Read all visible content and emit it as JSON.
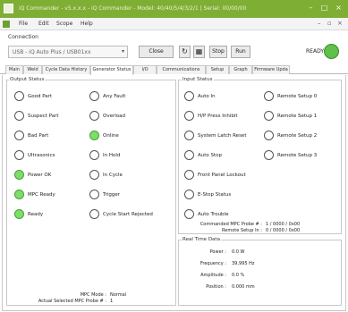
{
  "window": {
    "title": "iQ Commander - v5.x.x.x - iQ Commander - Model: 40/40/5/4/3/2/1 | Serial: 00/00/00",
    "minimize_glyph": "–",
    "maximize_glyph": "□",
    "close_glyph": "×"
  },
  "menubar": {
    "items": [
      "File",
      "Edit",
      "Scope",
      "Help"
    ],
    "mdi_controls": [
      "–",
      "▫",
      "×"
    ]
  },
  "connection": {
    "label": "Connection",
    "selected": "USB - iQ Auto Plus / USB01xx",
    "caret": "▾",
    "close_label": "Close",
    "refresh_glyph": "↻",
    "grid_glyph": "▦",
    "stop_label": "Stop",
    "run_label": "Run",
    "ready_label": "READY",
    "ready_color": "#5fc04a"
  },
  "tabs": [
    {
      "label": "Main"
    },
    {
      "label": "Weld"
    },
    {
      "label": "Cycle Data History"
    },
    {
      "label": "Generator Status",
      "active": true
    },
    {
      "label": "I/O"
    },
    {
      "label": "Communications"
    },
    {
      "label": "Setup"
    },
    {
      "label": "Graph"
    },
    {
      "label": "Firmware Upda"
    }
  ],
  "output_status": {
    "title": "Output Status",
    "left": [
      {
        "label": "Good Part",
        "on": false
      },
      {
        "label": "Suspect Part",
        "on": false
      },
      {
        "label": "Bad Part",
        "on": false
      },
      {
        "label": "Ultrasonics",
        "on": false
      },
      {
        "label": "Power OK",
        "on": true
      },
      {
        "label": "MPC Ready",
        "on": true
      },
      {
        "label": "Ready",
        "on": true
      }
    ],
    "right": [
      {
        "label": "Any Fault",
        "on": false
      },
      {
        "label": "Overload",
        "on": false
      },
      {
        "label": "Online",
        "on": true
      },
      {
        "label": "In Hold",
        "on": false
      },
      {
        "label": "In Cycle",
        "on": false
      },
      {
        "label": "Trigger",
        "on": false
      },
      {
        "label": "Cycle Start Rejected",
        "on": false
      }
    ],
    "mpc_mode_label": "MPC Mode :",
    "mpc_mode_value": "Normal",
    "actual_probe_label": "Actual Selected MPC Probe # :",
    "actual_probe_value": "1"
  },
  "input_status": {
    "title": "Input Status",
    "left": [
      {
        "label": "Auto In",
        "on": false
      },
      {
        "label": "H/P Press Inhibit",
        "on": false
      },
      {
        "label": "System Latch Reset",
        "on": false
      },
      {
        "label": "Auto Stop",
        "on": false
      },
      {
        "label": "Front Panel Lockout",
        "on": false
      },
      {
        "label": "E-Stop Status",
        "on": false
      },
      {
        "label": "Auto Trouble",
        "on": false
      }
    ],
    "right": [
      {
        "label": "Remote Setup 0",
        "on": false
      },
      {
        "label": "Remote Setup 1",
        "on": false
      },
      {
        "label": "Remote Setup 2",
        "on": false
      },
      {
        "label": "Remote Setup 3",
        "on": false
      }
    ],
    "commanded_probe_label": "Commanded MPC Probe # :",
    "commanded_probe_value": "1 / 0000 / 0x00",
    "remote_setup_label": "Remote Setup In :",
    "remote_setup_value": "0 / 0000 / 0x00"
  },
  "real_time": {
    "title": "Real Time Data",
    "rows": [
      {
        "label": "Power :",
        "value": "0.0 W"
      },
      {
        "label": "Frequency :",
        "value": "39,995 Hz"
      },
      {
        "label": "Amplitude :",
        "value": "0.0 %"
      },
      {
        "label": "Position :",
        "value": "0.000 mm"
      }
    ]
  }
}
